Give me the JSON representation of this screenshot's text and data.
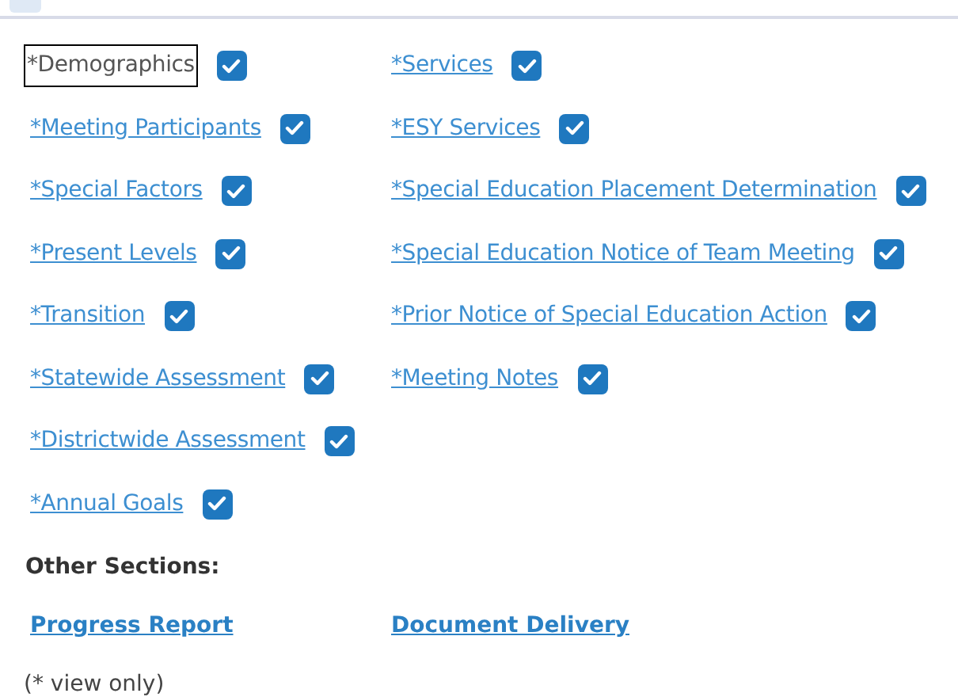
{
  "sections": {
    "columns": [
      [
        {
          "label": "*Demographics",
          "checked": true,
          "focused": true
        },
        {
          "label": "*Meeting Participants",
          "checked": true,
          "focused": false
        },
        {
          "label": "*Special Factors",
          "checked": true,
          "focused": false
        },
        {
          "label": "*Present Levels",
          "checked": true,
          "focused": false
        },
        {
          "label": "*Transition",
          "checked": true,
          "focused": false
        },
        {
          "label": "*Statewide Assessment",
          "checked": true,
          "focused": false
        },
        {
          "label": "*Districtwide Assessment",
          "checked": true,
          "focused": false
        },
        {
          "label": "*Annual Goals",
          "checked": true,
          "focused": false
        }
      ],
      [
        {
          "label": "*Services",
          "checked": true,
          "focused": false
        },
        {
          "label": "*ESY Services",
          "checked": true,
          "focused": false
        },
        {
          "label": "*Special Education Placement Determination",
          "checked": true,
          "focused": false
        },
        {
          "label": "*Special Education Notice of Team Meeting",
          "checked": true,
          "focused": false
        },
        {
          "label": "*Prior Notice of Special Education Action",
          "checked": true,
          "focused": false
        },
        {
          "label": "*Meeting Notes",
          "checked": true,
          "focused": false
        }
      ]
    ]
  },
  "other_sections": {
    "heading": "Other Sections:",
    "links": [
      "Progress Report",
      "Document Delivery"
    ]
  },
  "footnote": "(* view only)"
}
